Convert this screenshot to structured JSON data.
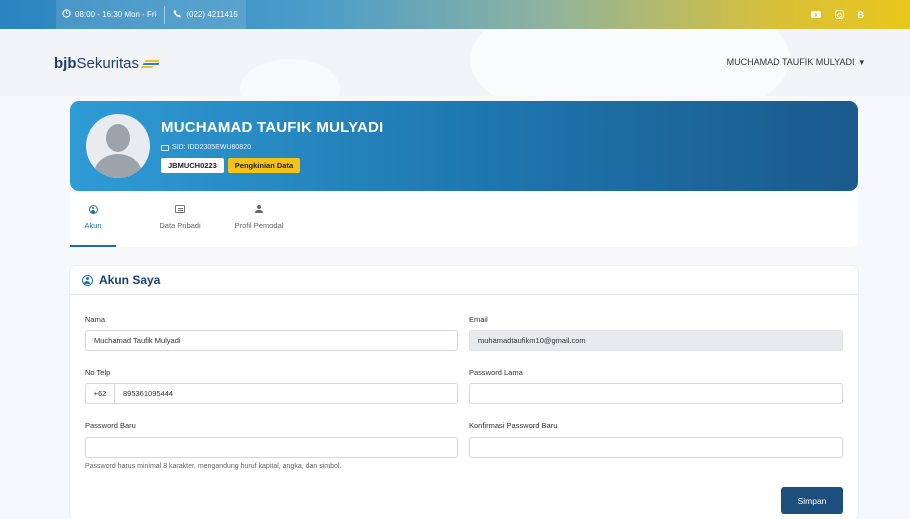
{
  "topbar": {
    "hours": "08:00 - 16:30 Mon - Fri",
    "phone": "(022) 4211415",
    "social": [
      "youtube-icon",
      "instagram-icon",
      "b-icon"
    ],
    "b_label": "B"
  },
  "header": {
    "logo_bold": "bjb",
    "logo_rest": "Sekuritas",
    "user_name": "MUCHAMAD TAUFIK MULYADI",
    "dropdown_caret": "▾"
  },
  "profile": {
    "name": "MUCHAMAD TAUFIK MULYADI",
    "sid": "SID: IDD2305EWU80820",
    "code": "JBMUCH0223",
    "update_label": "Pengkinian Data"
  },
  "tabs": [
    {
      "label": "Akun",
      "icon": "user-circle-icon",
      "active": true
    },
    {
      "label": "Data Pribadi",
      "icon": "document-icon",
      "active": false
    },
    {
      "label": "Profil Pemodal",
      "icon": "person-icon",
      "active": false
    }
  ],
  "form": {
    "title": "Akun Saya",
    "nama_label": "Nama",
    "nama_value": "Muchamad Taufik Mulyadi",
    "email_label": "Email",
    "email_value": "muhamadtaufikm10@gmail.com",
    "telp_label": "No Telp",
    "telp_prefix": "+62",
    "telp_value": "895361095444",
    "pw_lama_label": "Password Lama",
    "pw_lama_value": "",
    "pw_baru_label": "Password Baru",
    "pw_baru_value": "",
    "pw_konf_label": "Konfirmasi Password Baru",
    "pw_konf_value": "",
    "pw_hint": "Password harus minimal 8 karakter, mengandung huruf kapital, angka, dan simbol.",
    "save_label": "Simpan"
  },
  "colors": {
    "primary": "#1c4f7c",
    "accent_yellow": "#f5c315",
    "tab_active": "#1e6fa8"
  }
}
